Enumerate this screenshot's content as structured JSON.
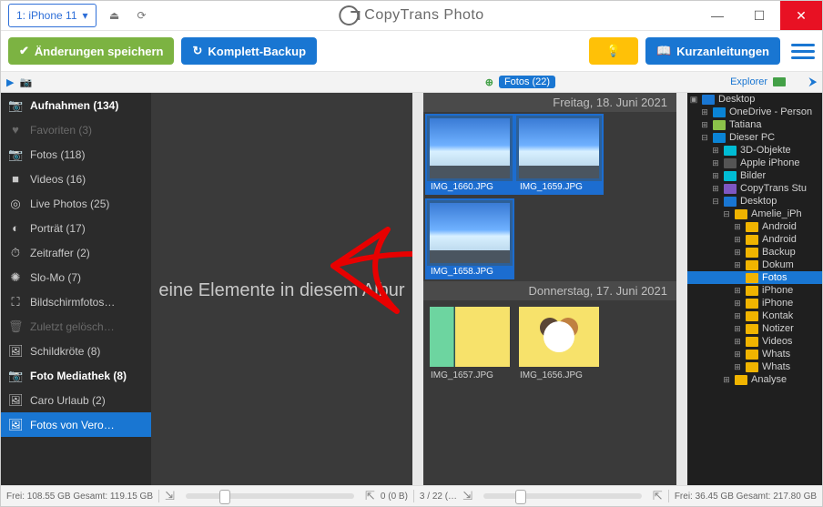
{
  "titlebar": {
    "device": "1: iPhone 11",
    "app_name": "CopyTrans Photo",
    "min": "—",
    "max": "☐",
    "close": "✕"
  },
  "cmdbar": {
    "save": "Änderungen speichern",
    "backup": "Komplett-Backup",
    "guides": "Kurzanleitungen"
  },
  "tabstrip": {
    "fotos_pill": "Fotos (22)",
    "explorer": "Explorer"
  },
  "sidebar": [
    {
      "icon": "📷",
      "label": "Aufnahmen (134)",
      "cls": "header",
      "name": "sb-aufnahmen"
    },
    {
      "icon": "♥",
      "label": "Favoriten (3)",
      "cls": "muted",
      "name": "sb-favoriten"
    },
    {
      "icon": "📷",
      "label": "Fotos (118)",
      "cls": "",
      "name": "sb-fotos"
    },
    {
      "icon": "■",
      "label": "Videos (16)",
      "cls": "",
      "name": "sb-videos"
    },
    {
      "icon": "◎",
      "label": "Live Photos (25)",
      "cls": "",
      "name": "sb-livephotos"
    },
    {
      "icon": "◐",
      "label": "Porträt (17)",
      "cls": "",
      "name": "sb-portrait"
    },
    {
      "icon": "⏱",
      "label": "Zeitraffer (2)",
      "cls": "",
      "name": "sb-zeitraffer"
    },
    {
      "icon": "✺",
      "label": "Slo-Mo (7)",
      "cls": "",
      "name": "sb-slomo"
    },
    {
      "icon": "⛶",
      "label": "Bildschirmfotos…",
      "cls": "",
      "name": "sb-screenshots"
    },
    {
      "icon": "🗑",
      "label": "Zuletzt gelösch…",
      "cls": "muted",
      "name": "sb-deleted"
    },
    {
      "icon": "🖼",
      "label": "Schildkröte (8)",
      "cls": "",
      "name": "sb-schildkroete"
    },
    {
      "icon": "📷",
      "label": "Foto Mediathek (8)",
      "cls": "header",
      "name": "sb-mediathek"
    },
    {
      "icon": "🖼",
      "label": "Caro Urlaub (2)",
      "cls": "",
      "name": "sb-caro"
    },
    {
      "icon": "🖼",
      "label": "Fotos von Vero…",
      "cls": "selected",
      "name": "sb-vero"
    }
  ],
  "dropzone": {
    "text": "eine Elemente in diesem Albur"
  },
  "pc": {
    "groups": [
      {
        "date": "Freitag, 18. Juni 2021",
        "photos": [
          {
            "cap": "IMG_1660.JPG",
            "kind": "sky",
            "sel": true
          },
          {
            "cap": "IMG_1659.JPG",
            "kind": "sky",
            "sel": true
          }
        ],
        "photos2": [
          {
            "cap": "IMG_1658.JPG",
            "kind": "sky",
            "sel": true
          }
        ]
      },
      {
        "date": "Donnerstag, 17. Juni 2021",
        "photos": [
          {
            "cap": "IMG_1657.JPG",
            "kind": "yellow",
            "sel": false
          },
          {
            "cap": "IMG_1656.JPG",
            "kind": "dog",
            "sel": false
          }
        ]
      }
    ]
  },
  "tree": [
    {
      "d": 0,
      "tw": "▣",
      "ico": "blue",
      "t": "Desktop"
    },
    {
      "d": 1,
      "tw": "⊞",
      "ico": "cloud",
      "t": "OneDrive - Person"
    },
    {
      "d": 1,
      "tw": "⊞",
      "ico": "user",
      "t": "Tatiana"
    },
    {
      "d": 1,
      "tw": "⊟",
      "ico": "pc",
      "t": "Dieser PC"
    },
    {
      "d": 2,
      "tw": "⊞",
      "ico": "cube",
      "t": "3D-Objekte"
    },
    {
      "d": 2,
      "tw": "⊞",
      "ico": "phone",
      "t": "Apple iPhone"
    },
    {
      "d": 2,
      "tw": "⊞",
      "ico": "pic",
      "t": "Bilder"
    },
    {
      "d": 2,
      "tw": "⊞",
      "ico": "ct",
      "t": "CopyTrans Stu"
    },
    {
      "d": 2,
      "tw": "⊟",
      "ico": "blue",
      "t": "Desktop"
    },
    {
      "d": 3,
      "tw": "⊟",
      "ico": "fld",
      "t": "Amelie_iPh"
    },
    {
      "d": 4,
      "tw": "⊞",
      "ico": "fld",
      "t": "Android"
    },
    {
      "d": 4,
      "tw": "⊞",
      "ico": "fld",
      "t": "Android"
    },
    {
      "d": 4,
      "tw": "⊞",
      "ico": "fld",
      "t": "Backup"
    },
    {
      "d": 4,
      "tw": "⊞",
      "ico": "fld",
      "t": "Dokum"
    },
    {
      "d": 4,
      "tw": "",
      "ico": "fld",
      "t": "Fotos",
      "sel": true
    },
    {
      "d": 4,
      "tw": "⊞",
      "ico": "fld",
      "t": "iPhone"
    },
    {
      "d": 4,
      "tw": "⊞",
      "ico": "fld",
      "t": "iPhone"
    },
    {
      "d": 4,
      "tw": "⊞",
      "ico": "fld",
      "t": "Kontak"
    },
    {
      "d": 4,
      "tw": "⊞",
      "ico": "fld",
      "t": "Notizer"
    },
    {
      "d": 4,
      "tw": "⊞",
      "ico": "fld",
      "t": "Videos"
    },
    {
      "d": 4,
      "tw": "⊞",
      "ico": "fld",
      "t": "Whats"
    },
    {
      "d": 4,
      "tw": "⊞",
      "ico": "fld",
      "t": "Whats"
    },
    {
      "d": 3,
      "tw": "⊞",
      "ico": "fld",
      "t": "Analyse"
    }
  ],
  "status": {
    "left_free": "Frei: 108.55 GB Gesamt: 119.15 GB",
    "center_left": "0 (0 B)",
    "center_right": "3 / 22 (…",
    "right_free": "Frei: 36.45 GB Gesamt: 217.80 GB"
  }
}
